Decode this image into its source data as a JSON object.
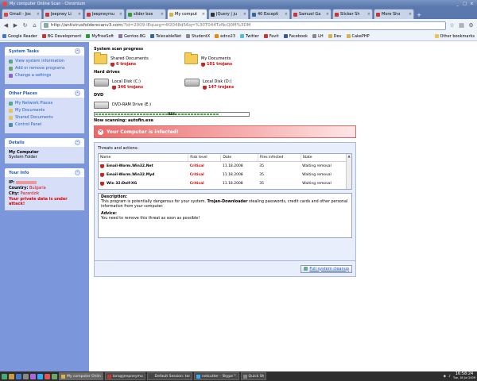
{
  "window": {
    "title": "My computer Online Scan - Chromium"
  },
  "tabs": [
    {
      "label": "Gmail - Jos",
      "color": "#d44"
    },
    {
      "label": "Jeepney Li",
      "color": "#c33"
    },
    {
      "label": "Jeepneymu",
      "color": "#c33"
    },
    {
      "label": "slider box",
      "color": "#393"
    },
    {
      "label": "My comput",
      "color": "#d9b24c",
      "active": true
    },
    {
      "label": "JQuery | ju",
      "color": "#333"
    },
    {
      "label": "40 Excepti",
      "color": "#369"
    },
    {
      "label": "Samuel Ga",
      "color": "#c33"
    },
    {
      "label": "Slicker Sh",
      "color": "#c33"
    },
    {
      "label": "More Sho",
      "color": "#c33"
    }
  ],
  "toolbar": {
    "url_host": "http://antivirusfolderscanv3.com",
    "url_rest": "/?id=2009-lEqueg=4f2048d56q=%30T044TzNcQ0M%3DM"
  },
  "bookmarks": [
    {
      "label": "Google Reader",
      "color": "#47c"
    },
    {
      "label": "BG Development",
      "color": "#c33"
    },
    {
      "label": "MyFreeSoft",
      "color": "#393"
    },
    {
      "label": "Gentoo.BG",
      "color": "#879"
    },
    {
      "label": "TelecableNet",
      "color": "#369"
    },
    {
      "label": "StudentX",
      "color": "#888"
    },
    {
      "label": "edno23",
      "color": "#e80"
    },
    {
      "label": "Twitter",
      "color": "#5bd"
    },
    {
      "label": "Favit",
      "color": "#c33"
    },
    {
      "label": "Facebook",
      "color": "#3b5998"
    },
    {
      "label": "LH",
      "color": "#888"
    },
    {
      "label": "Dev",
      "color": "#d9b24c"
    },
    {
      "label": "CakePHP",
      "color": "#d9b24c"
    }
  ],
  "bookmarks_other": "Other bookmarks",
  "sidebar": {
    "tasks": {
      "title": "System Tasks",
      "items": [
        {
          "label": "View system information",
          "color": "#5a8"
        },
        {
          "label": "Add or remove programs",
          "color": "#6a6"
        },
        {
          "label": "Change a settings",
          "color": "#86c"
        }
      ]
    },
    "places": {
      "title": "Other Places",
      "items": [
        {
          "label": "My Network Places",
          "color": "#5a8"
        },
        {
          "label": "My Documents",
          "color": "#e5c55a"
        },
        {
          "label": "Shared Documents",
          "color": "#e5c55a"
        },
        {
          "label": "Control Panel",
          "color": "#58a"
        }
      ]
    },
    "details": {
      "title": "Details",
      "name": "My Computer",
      "sub": "System Folder"
    },
    "info": {
      "title": "Your Info",
      "ip_label": "IP:",
      "country_label": "Country:",
      "country": "Bulgaria",
      "city_label": "City:",
      "city": "Pazardzik",
      "warning": "Your private data is under attack!"
    }
  },
  "scan": {
    "progress_title": "System scan progress",
    "folders": [
      {
        "name": "Shared Documents",
        "trojans": "6 trojans"
      },
      {
        "name": "My Documents",
        "trojans": "101 trojans"
      }
    ],
    "drives_title": "Hard drives",
    "drives": [
      {
        "name": "Local Disk (C:)",
        "trojans": "346 trojans"
      },
      {
        "name": "Local Disk (D:)",
        "trojans": "147 trojans"
      }
    ],
    "dvd_title": "DVD",
    "dvd": {
      "name": "DVD-RAM Drive (E:)"
    },
    "progress_pct": "81%",
    "progress_value": 0.81,
    "now_scanning": "Now scanning: autofin.exe"
  },
  "alert": {
    "text": "Your Computer is infected!"
  },
  "threats": {
    "label": "Threats and actions:",
    "columns": [
      "Name",
      "Risk level",
      "Date",
      "Files infected",
      "State"
    ],
    "rows": [
      {
        "name": "Email-Worm.Win32.Net",
        "risk": "Critical",
        "date": "11.18.2008",
        "files": "35",
        "state": "Waiting removal"
      },
      {
        "name": "Email-Worm.Win32.Myd",
        "risk": "Critical",
        "date": "11.18.2008",
        "files": "35",
        "state": "Waiting removal"
      },
      {
        "name": "Win 32:Delf-XG",
        "risk": "Critical",
        "date": "11.18.2008",
        "files": "35",
        "state": "Waiting removal"
      }
    ]
  },
  "description": {
    "head": "Description:",
    "text_a": "This program is potentially dangerous for your system.",
    "text_b": "Trojan-Downloader",
    "text_c": "stealing passwords, credit cards and other personal information from your computer.",
    "advice_head": "Advice:",
    "advice_text": "You need to remove this threat as soon as possible!"
  },
  "cleanup": {
    "label": "Full system cleanup"
  },
  "taskbar": {
    "tasks": [
      {
        "label": "My computer Onlin",
        "color": "#d9b24c",
        "active": true
      },
      {
        "label": "lars@jeepneymu",
        "color": "#c33"
      },
      {
        "label": "Default Session: ter",
        "color": "#444"
      },
      {
        "label": "netcutter - Skype™",
        "color": "#3af"
      },
      {
        "label": "Quick Sh",
        "color": "#888"
      }
    ],
    "time": "16:58:24",
    "date": "Tue, 18 Jul 2009"
  }
}
